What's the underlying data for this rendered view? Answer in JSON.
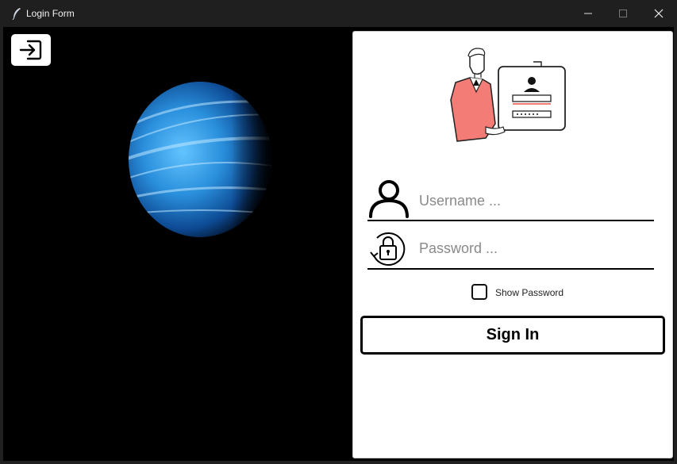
{
  "window": {
    "title": "Login Form",
    "controls": [
      "minimize-icon",
      "maximize-icon",
      "close-icon"
    ]
  },
  "left_pane": {
    "exit_button_icon": "exit-arrow-icon",
    "image": "blue-planet"
  },
  "login": {
    "illustration": "person-holding-login-card",
    "username": {
      "icon": "user-icon",
      "placeholder": "Username ..."
    },
    "password": {
      "icon": "lock-icon",
      "placeholder": "Password ..."
    },
    "show_password_label": "Show Password",
    "show_password_checked": false,
    "sign_in_label": "Sign In"
  },
  "colors": {
    "accent_coral": "#f47c76",
    "background_dark": "#000000",
    "panel": "#ffffff"
  }
}
